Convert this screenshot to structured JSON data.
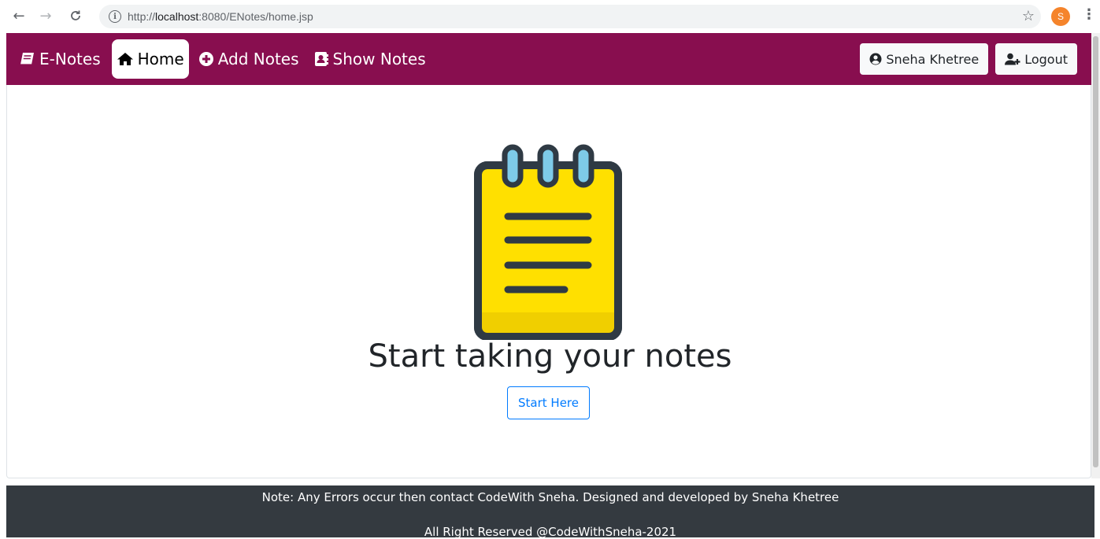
{
  "browser": {
    "url_prefix": "http://",
    "url_host": "localhost",
    "url_rest": ":8080/ENotes/home.jsp",
    "profile_initial": "S",
    "back_icon": "arrow-left-icon",
    "forward_icon": "arrow-right-icon",
    "reload_icon": "reload-icon"
  },
  "navbar": {
    "brand": "E-Notes",
    "items": [
      {
        "label": "Home",
        "icon": "home-icon",
        "active": true
      },
      {
        "label": "Add Notes",
        "icon": "plus-circle-icon",
        "active": false
      },
      {
        "label": "Show Notes",
        "icon": "address-book-icon",
        "active": false
      }
    ],
    "user_button": "Sneha Khetree",
    "logout_button": "Logout"
  },
  "hero": {
    "title": "Start taking your notes",
    "button": "Start Here"
  },
  "footer": {
    "line1": "Note: Any Errors occur then contact CodeWith Sneha. Designed and developed by Sneha Khetree",
    "line2": "All Right Reserved @CodeWithSneha-2021"
  },
  "colors": {
    "navbar_bg": "#880e4f",
    "footer_bg": "#343a40",
    "primary": "#007bff",
    "notepad_yellow": "#ffe000",
    "notepad_outline": "#2f3a44"
  }
}
